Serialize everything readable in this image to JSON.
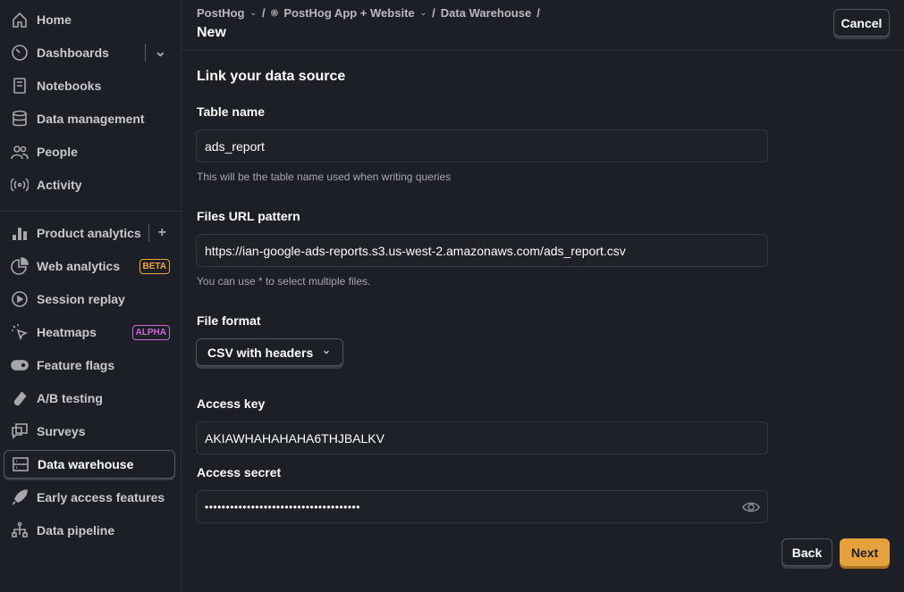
{
  "sidebar": {
    "items": [
      {
        "label": "Home",
        "icon": "home-icon"
      },
      {
        "label": "Dashboards",
        "icon": "dashboard-icon"
      },
      {
        "label": "Notebooks",
        "icon": "notebook-icon"
      },
      {
        "label": "Data management",
        "icon": "database-icon"
      },
      {
        "label": "People",
        "icon": "people-icon"
      },
      {
        "label": "Activity",
        "icon": "activity-icon"
      },
      {
        "label": "Product analytics",
        "icon": "bar-chart-icon"
      },
      {
        "label": "Web analytics",
        "icon": "pie-chart-icon",
        "badge": "BETA"
      },
      {
        "label": "Session replay",
        "icon": "replay-icon"
      },
      {
        "label": "Heatmaps",
        "icon": "cursor-click-icon",
        "badge": "ALPHA"
      },
      {
        "label": "Feature flags",
        "icon": "toggle-icon"
      },
      {
        "label": "A/B testing",
        "icon": "flask-icon"
      },
      {
        "label": "Surveys",
        "icon": "chat-icon"
      },
      {
        "label": "Data warehouse",
        "icon": "server-icon",
        "active": true
      },
      {
        "label": "Early access features",
        "icon": "rocket-icon"
      },
      {
        "label": "Data pipeline",
        "icon": "pipeline-icon"
      }
    ],
    "badge_colors": {
      "beta": "#f0a53c",
      "alpha": "#c86bd8"
    }
  },
  "header": {
    "breadcrumbs": [
      "PostHog",
      "PostHog App + Website",
      "Data Warehouse"
    ],
    "title": "New",
    "cancel_label": "Cancel"
  },
  "form": {
    "heading": "Link your data source",
    "table_name": {
      "label": "Table name",
      "value": "ads_report",
      "hint": "This will be the table name used when writing queries"
    },
    "files_url": {
      "label": "Files URL pattern",
      "value": "https://ian-google-ads-reports.s3.us-west-2.amazonaws.com/ads_report.csv",
      "hint": "You can use * to select multiple files."
    },
    "file_format": {
      "label": "File format",
      "value": "CSV with headers"
    },
    "access_key": {
      "label": "Access key",
      "value": "AKIAWHAHAHAHA6THJBALKV"
    },
    "access_secret": {
      "label": "Access secret",
      "value": "•••••••••••••••••••••••••••••••••••••"
    },
    "back_label": "Back",
    "next_label": "Next",
    "accent": "#e5a23c"
  }
}
